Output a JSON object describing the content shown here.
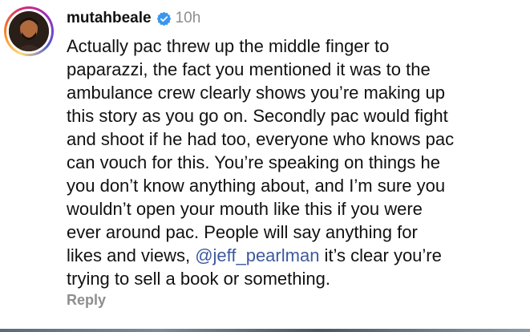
{
  "comment": {
    "username": "mutahbeale",
    "verified": true,
    "time": "10h",
    "text_lines": [
      "Actually pac threw up the middle finger to",
      "paparazzi, the fact you mentioned it was to the",
      "ambulance crew clearly shows you’re making up",
      "this story as you go on. Secondly pac would fight",
      "and shoot if he had too, everyone who knows pac",
      "can vouch for this. You’re speaking on things he",
      "you don’t know anything about, and I’m sure you",
      "wouldn’t open your mouth like this if you were",
      "ever around pac. People will say anything for",
      "likes and views, ",
      "trying to sell a book or something."
    ],
    "mention": "@jeff_pearlman",
    "line10_after_mention": " it’s clear you’re",
    "reply_label": "Reply"
  },
  "colors": {
    "verified_badge": "#3897f0",
    "mention": "#3d5a9e",
    "muted": "#8e8e8e",
    "text": "#111111"
  },
  "icons": {
    "verified": "verified-badge-icon"
  }
}
